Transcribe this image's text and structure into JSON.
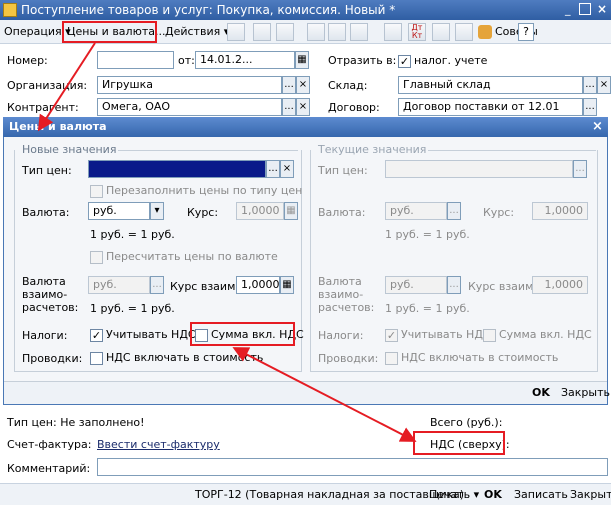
{
  "window": {
    "title": "Поступление товаров и услуг: Покупка, комиссия. Новый *"
  },
  "toolbar": {
    "operation": "Операция",
    "prices": "Цены и валюта...",
    "actions": "Действия",
    "at_dt": "Дт\nКт",
    "tips": "Советы",
    "help": "?"
  },
  "header_form": {
    "number_label": "Номер:",
    "number_value": "",
    "from_label": "от:",
    "date_value": "14.01.2...",
    "reflect_label": "Отразить в:",
    "tax_account_label": "налог. учете",
    "org_label": "Организация:",
    "org_value": "Игрушка",
    "warehouse_label": "Склад:",
    "warehouse_value": "Главный склад",
    "contractor_label": "Контрагент:",
    "contractor_value": "Омега, ОАО",
    "contract_label": "Договор:",
    "contract_value": "Договор поставки от 12.01"
  },
  "dialog": {
    "title": "Цены и валюта",
    "new_group": "Новые значения",
    "current_group": "Текущие значения",
    "price_type_label": "Тип цен:",
    "refill_prices": "Перезаполнить цены по типу цен",
    "currency_label": "Валюта:",
    "currency_value": "руб.",
    "rate_label": "Курс:",
    "rate_value": "1,0000",
    "one_rub": "1 руб. = 1 руб.",
    "recalc_prices": "Пересчитать цены по валюте",
    "settlement_currency_label": "Валюта взаимо-расчетов:",
    "settlement_currency_value": "руб.",
    "mutual_rate_label": "Курс взаим.:",
    "mutual_rate_value": "1,0000",
    "taxes_label": "Налоги:",
    "consider_vat": "Учитывать НДС",
    "sum_incl_vat": "Сумма вкл. НДС",
    "postings_label": "Проводки:",
    "vat_in_cost": "НДС включать в стоимость",
    "ok": "OK",
    "close": "Закрыть"
  },
  "footer_form": {
    "price_type_status": "Тип цен: Не заполнено!",
    "total_label": "Всего (руб.):",
    "invoice_label": "Счет-фактура:",
    "invoice_link": "Ввести счет-фактуру",
    "vat_label": "НДС (сверху):",
    "comment_label": "Комментарий:",
    "comment_value": ""
  },
  "bottom_bar": {
    "torg12": "ТОРГ-12 (Товарная накладная за поставщика)",
    "print": "Печать",
    "ok": "OK",
    "save": "Записать",
    "close": "Закрыть"
  },
  "colors": {
    "titlebar": "#3a66a8",
    "dialog_border": "#4a78b5",
    "highlight": "#e51c23",
    "selected_field": "#0a1a8a"
  }
}
